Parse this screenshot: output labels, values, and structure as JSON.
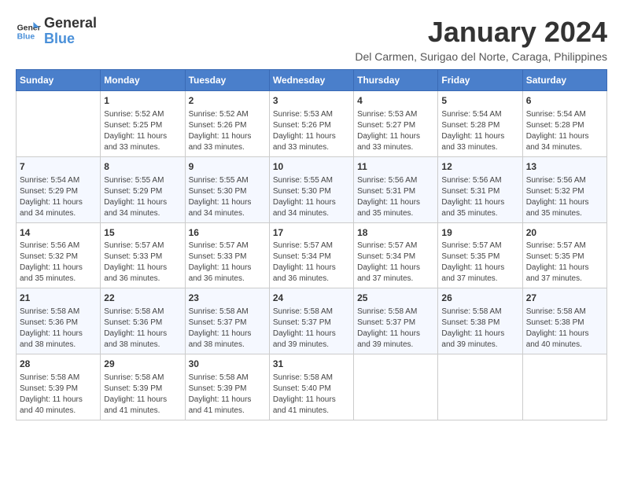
{
  "header": {
    "logo_line1": "General",
    "logo_line2": "Blue",
    "month_title": "January 2024",
    "subtitle": "Del Carmen, Surigao del Norte, Caraga, Philippines"
  },
  "days_of_week": [
    "Sunday",
    "Monday",
    "Tuesday",
    "Wednesday",
    "Thursday",
    "Friday",
    "Saturday"
  ],
  "weeks": [
    [
      {
        "day": "",
        "info": ""
      },
      {
        "day": "1",
        "info": "Sunrise: 5:52 AM\nSunset: 5:25 PM\nDaylight: 11 hours\nand 33 minutes."
      },
      {
        "day": "2",
        "info": "Sunrise: 5:52 AM\nSunset: 5:26 PM\nDaylight: 11 hours\nand 33 minutes."
      },
      {
        "day": "3",
        "info": "Sunrise: 5:53 AM\nSunset: 5:26 PM\nDaylight: 11 hours\nand 33 minutes."
      },
      {
        "day": "4",
        "info": "Sunrise: 5:53 AM\nSunset: 5:27 PM\nDaylight: 11 hours\nand 33 minutes."
      },
      {
        "day": "5",
        "info": "Sunrise: 5:54 AM\nSunset: 5:28 PM\nDaylight: 11 hours\nand 33 minutes."
      },
      {
        "day": "6",
        "info": "Sunrise: 5:54 AM\nSunset: 5:28 PM\nDaylight: 11 hours\nand 34 minutes."
      }
    ],
    [
      {
        "day": "7",
        "info": "Sunrise: 5:54 AM\nSunset: 5:29 PM\nDaylight: 11 hours\nand 34 minutes."
      },
      {
        "day": "8",
        "info": "Sunrise: 5:55 AM\nSunset: 5:29 PM\nDaylight: 11 hours\nand 34 minutes."
      },
      {
        "day": "9",
        "info": "Sunrise: 5:55 AM\nSunset: 5:30 PM\nDaylight: 11 hours\nand 34 minutes."
      },
      {
        "day": "10",
        "info": "Sunrise: 5:55 AM\nSunset: 5:30 PM\nDaylight: 11 hours\nand 34 minutes."
      },
      {
        "day": "11",
        "info": "Sunrise: 5:56 AM\nSunset: 5:31 PM\nDaylight: 11 hours\nand 35 minutes."
      },
      {
        "day": "12",
        "info": "Sunrise: 5:56 AM\nSunset: 5:31 PM\nDaylight: 11 hours\nand 35 minutes."
      },
      {
        "day": "13",
        "info": "Sunrise: 5:56 AM\nSunset: 5:32 PM\nDaylight: 11 hours\nand 35 minutes."
      }
    ],
    [
      {
        "day": "14",
        "info": "Sunrise: 5:56 AM\nSunset: 5:32 PM\nDaylight: 11 hours\nand 35 minutes."
      },
      {
        "day": "15",
        "info": "Sunrise: 5:57 AM\nSunset: 5:33 PM\nDaylight: 11 hours\nand 36 minutes."
      },
      {
        "day": "16",
        "info": "Sunrise: 5:57 AM\nSunset: 5:33 PM\nDaylight: 11 hours\nand 36 minutes."
      },
      {
        "day": "17",
        "info": "Sunrise: 5:57 AM\nSunset: 5:34 PM\nDaylight: 11 hours\nand 36 minutes."
      },
      {
        "day": "18",
        "info": "Sunrise: 5:57 AM\nSunset: 5:34 PM\nDaylight: 11 hours\nand 37 minutes."
      },
      {
        "day": "19",
        "info": "Sunrise: 5:57 AM\nSunset: 5:35 PM\nDaylight: 11 hours\nand 37 minutes."
      },
      {
        "day": "20",
        "info": "Sunrise: 5:57 AM\nSunset: 5:35 PM\nDaylight: 11 hours\nand 37 minutes."
      }
    ],
    [
      {
        "day": "21",
        "info": "Sunrise: 5:58 AM\nSunset: 5:36 PM\nDaylight: 11 hours\nand 38 minutes."
      },
      {
        "day": "22",
        "info": "Sunrise: 5:58 AM\nSunset: 5:36 PM\nDaylight: 11 hours\nand 38 minutes."
      },
      {
        "day": "23",
        "info": "Sunrise: 5:58 AM\nSunset: 5:37 PM\nDaylight: 11 hours\nand 38 minutes."
      },
      {
        "day": "24",
        "info": "Sunrise: 5:58 AM\nSunset: 5:37 PM\nDaylight: 11 hours\nand 39 minutes."
      },
      {
        "day": "25",
        "info": "Sunrise: 5:58 AM\nSunset: 5:37 PM\nDaylight: 11 hours\nand 39 minutes."
      },
      {
        "day": "26",
        "info": "Sunrise: 5:58 AM\nSunset: 5:38 PM\nDaylight: 11 hours\nand 39 minutes."
      },
      {
        "day": "27",
        "info": "Sunrise: 5:58 AM\nSunset: 5:38 PM\nDaylight: 11 hours\nand 40 minutes."
      }
    ],
    [
      {
        "day": "28",
        "info": "Sunrise: 5:58 AM\nSunset: 5:39 PM\nDaylight: 11 hours\nand 40 minutes."
      },
      {
        "day": "29",
        "info": "Sunrise: 5:58 AM\nSunset: 5:39 PM\nDaylight: 11 hours\nand 41 minutes."
      },
      {
        "day": "30",
        "info": "Sunrise: 5:58 AM\nSunset: 5:39 PM\nDaylight: 11 hours\nand 41 minutes."
      },
      {
        "day": "31",
        "info": "Sunrise: 5:58 AM\nSunset: 5:40 PM\nDaylight: 11 hours\nand 41 minutes."
      },
      {
        "day": "",
        "info": ""
      },
      {
        "day": "",
        "info": ""
      },
      {
        "day": "",
        "info": ""
      }
    ]
  ]
}
